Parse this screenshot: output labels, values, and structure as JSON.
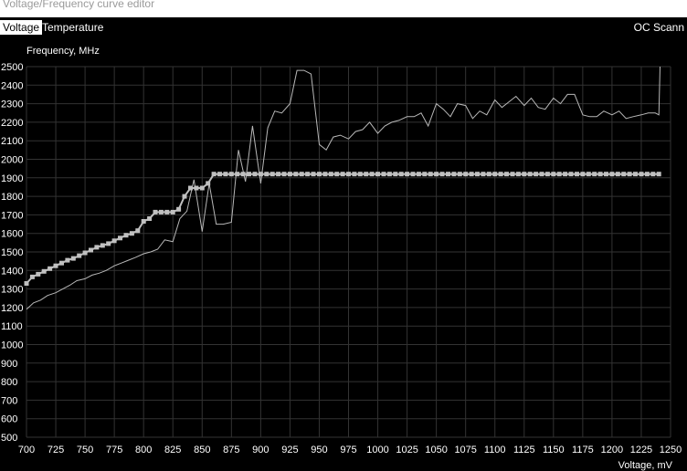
{
  "window": {
    "title": "Voltage/Frequency curve editor"
  },
  "tabs": [
    {
      "label": "Voltage",
      "active": true
    },
    {
      "label": "Temperature",
      "active": false
    }
  ],
  "oc_scanner": {
    "label": "OC Scann"
  },
  "colors": {
    "background": "#000000",
    "grid": "#333333",
    "curve": "#b8b8b8",
    "point": "#c0c0c0",
    "text": "#ffffff"
  },
  "chart_data": {
    "type": "line",
    "ylabel": "Frequency, MHz",
    "xlabel": "Voltage, mV",
    "xlim": [
      700,
      1250
    ],
    "ylim": [
      500,
      2500
    ],
    "x_ticks": [
      "700",
      "725",
      "750",
      "775",
      "800",
      "825",
      "850",
      "875",
      "900",
      "925",
      "950",
      "975",
      "1000",
      "1025",
      "1050",
      "1075",
      "1100",
      "1125",
      "1150",
      "1175",
      "1200",
      "1225",
      "1250"
    ],
    "y_ticks": [
      "2500",
      "2400",
      "2300",
      "2200",
      "2100",
      "2000",
      "1900",
      "1800",
      "1700",
      "1600",
      "1500",
      "1400",
      "1300",
      "1200",
      "1100",
      "1000",
      "900",
      "800",
      "700",
      "600",
      "500"
    ],
    "grid": true,
    "series": [
      {
        "style": "thin-line",
        "x": [
          700,
          706,
          712,
          718,
          725,
          731,
          737,
          743,
          750,
          756,
          762,
          768,
          775,
          781,
          787,
          793,
          800,
          806,
          812,
          818,
          825,
          831,
          837,
          843,
          850,
          856,
          862,
          868,
          875,
          881,
          887,
          893,
          900,
          906,
          912,
          918,
          925,
          931,
          937,
          943,
          950,
          956,
          962,
          968,
          975,
          981,
          987,
          993,
          1000,
          1006,
          1012,
          1018,
          1025,
          1031,
          1037,
          1043,
          1050,
          1056,
          1062,
          1068,
          1075,
          1081,
          1087,
          1093,
          1100,
          1106,
          1112,
          1118,
          1125,
          1131,
          1137,
          1143,
          1150,
          1156,
          1162,
          1168,
          1175,
          1181,
          1187,
          1193,
          1200,
          1206,
          1212,
          1218,
          1225,
          1231,
          1237,
          1240,
          1241
        ],
        "y": [
          1190,
          1225,
          1240,
          1265,
          1280,
          1300,
          1320,
          1345,
          1355,
          1375,
          1385,
          1400,
          1425,
          1440,
          1455,
          1470,
          1490,
          1500,
          1515,
          1565,
          1555,
          1680,
          1720,
          1890,
          1610,
          1870,
          1650,
          1650,
          1660,
          2050,
          1880,
          2180,
          1870,
          2170,
          2260,
          2250,
          2300,
          2480,
          2480,
          2460,
          2080,
          2050,
          2120,
          2130,
          2110,
          2150,
          2160,
          2200,
          2140,
          2180,
          2200,
          2210,
          2230,
          2230,
          2250,
          2180,
          2300,
          2270,
          2230,
          2300,
          2290,
          2220,
          2260,
          2240,
          2320,
          2280,
          2310,
          2340,
          2290,
          2330,
          2280,
          2270,
          2330,
          2300,
          2350,
          2350,
          2240,
          2230,
          2230,
          2260,
          2240,
          2260,
          2220,
          2230,
          2240,
          2250,
          2250,
          2240,
          2500
        ]
      },
      {
        "style": "point-curve",
        "x": [
          700,
          705,
          710,
          715,
          720,
          725,
          730,
          735,
          740,
          745,
          750,
          755,
          760,
          765,
          770,
          775,
          780,
          785,
          790,
          795,
          800,
          805,
          810,
          815,
          820,
          825,
          830,
          835,
          840,
          845,
          850,
          855,
          860,
          865,
          870,
          875,
          880,
          885,
          890,
          895,
          900,
          905,
          910,
          915,
          920,
          925,
          930,
          935,
          940,
          945,
          950,
          955,
          960,
          965,
          970,
          975,
          980,
          985,
          990,
          995,
          1000,
          1005,
          1010,
          1015,
          1020,
          1025,
          1030,
          1035,
          1040,
          1045,
          1050,
          1055,
          1060,
          1065,
          1070,
          1075,
          1080,
          1085,
          1090,
          1095,
          1100,
          1105,
          1110,
          1115,
          1120,
          1125,
          1130,
          1135,
          1140,
          1145,
          1150,
          1155,
          1160,
          1165,
          1170,
          1175,
          1180,
          1185,
          1190,
          1195,
          1200,
          1205,
          1210,
          1215,
          1220,
          1225,
          1230,
          1235,
          1240
        ],
        "y": [
          1330,
          1365,
          1380,
          1395,
          1410,
          1425,
          1440,
          1455,
          1465,
          1480,
          1495,
          1510,
          1525,
          1535,
          1545,
          1560,
          1575,
          1590,
          1600,
          1615,
          1665,
          1680,
          1715,
          1715,
          1715,
          1715,
          1730,
          1800,
          1845,
          1845,
          1845,
          1870,
          1920,
          1920,
          1920,
          1920,
          1920,
          1920,
          1920,
          1920,
          1920,
          1920,
          1920,
          1920,
          1920,
          1920,
          1920,
          1920,
          1920,
          1920,
          1920,
          1920,
          1920,
          1920,
          1920,
          1920,
          1920,
          1920,
          1920,
          1920,
          1920,
          1920,
          1920,
          1920,
          1920,
          1920,
          1920,
          1920,
          1920,
          1920,
          1920,
          1920,
          1920,
          1920,
          1920,
          1920,
          1920,
          1920,
          1920,
          1920,
          1920,
          1920,
          1920,
          1920,
          1920,
          1920,
          1920,
          1920,
          1920,
          1920,
          1920,
          1920,
          1920,
          1920,
          1920,
          1920,
          1920,
          1920,
          1920,
          1920,
          1920,
          1920,
          1920,
          1920,
          1920,
          1920,
          1920,
          1920,
          1920
        ]
      }
    ]
  }
}
